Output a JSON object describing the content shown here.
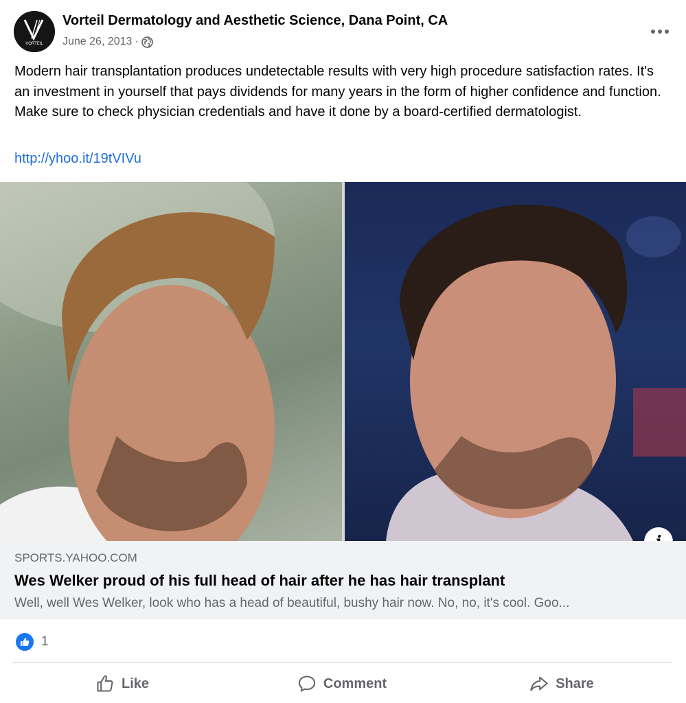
{
  "post": {
    "page_name": "Vorteil Dermatology and Aesthetic Science, Dana Point, CA",
    "avatar_text": "VORTEIL",
    "date": "June 26, 2013",
    "separator": "·",
    "audience_icon": "globe-icon",
    "more_icon": "ellipsis-icon",
    "text": "Modern hair transplantation produces undetectable results with very high procedure satisfaction rates. It's an investment in yourself that pays dividends for many years in the form of higher confidence and function. Make sure to check physician credentials and have it done by a board-certified dermatologist.",
    "link_text": "http://yhoo.it/19tVIVu"
  },
  "link_preview": {
    "info_icon": "info-icon",
    "info_glyph": "i",
    "domain": "SPORTS.YAHOO.COM",
    "headline": "Wes Welker proud of his full head of hair after he has hair transplant",
    "description": "Well, well Wes Welker, look who has a head of beautiful, bushy hair now. No, no, it's cool. Goo..."
  },
  "reactions": {
    "icon": "like-reaction-icon",
    "count": "1"
  },
  "actions": {
    "like_label": "Like",
    "comment_label": "Comment",
    "share_label": "Share"
  },
  "colors": {
    "link": "#216fdb",
    "secondary_text": "#65676b",
    "like_blue": "#1877f2",
    "caption_bg": "#f0f2f5"
  }
}
